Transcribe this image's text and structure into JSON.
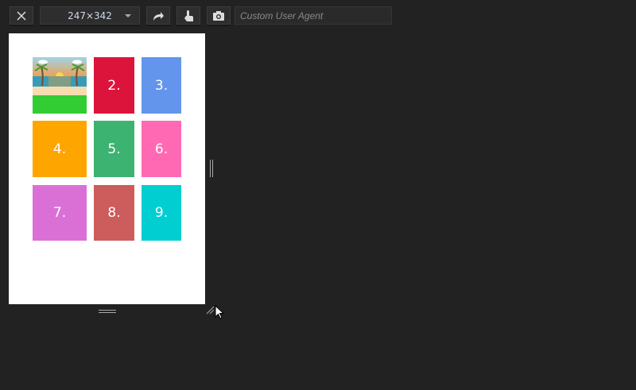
{
  "toolbar": {
    "size_value": "247×342",
    "ua_placeholder": "Custom User Agent"
  },
  "tiles": [
    {
      "label": "",
      "color": "#32cd32",
      "image": "beach-sunset"
    },
    {
      "label": "2.",
      "color": "#dc143c"
    },
    {
      "label": "3.",
      "color": "#6495ed"
    },
    {
      "label": "4.",
      "color": "#ffa500"
    },
    {
      "label": "5.",
      "color": "#3cb371"
    },
    {
      "label": "6.",
      "color": "#ff69b4"
    },
    {
      "label": "7.",
      "color": "#da70d6"
    },
    {
      "label": "8.",
      "color": "#cd5c5c"
    },
    {
      "label": "9.",
      "color": "#00ced1"
    }
  ]
}
